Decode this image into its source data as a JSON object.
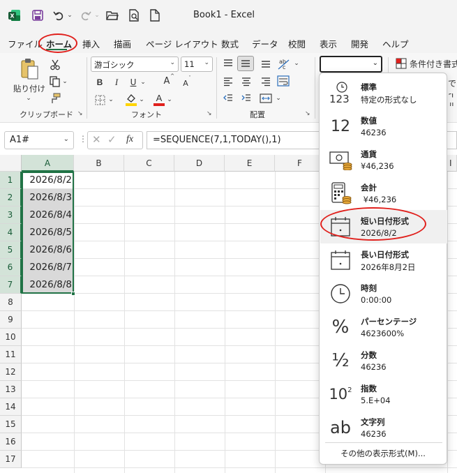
{
  "title_bar": {
    "app_title": "Book1  -  Excel",
    "icons": [
      "excel-logo-icon",
      "save-icon",
      "undo-icon",
      "redo-icon",
      "open-folder-icon",
      "print-preview-icon",
      "new-document-icon"
    ]
  },
  "menu": {
    "tabs": [
      "ファイル",
      "ホーム",
      "挿入",
      "描画",
      "ページ レイアウト",
      "数式",
      "データ",
      "校閲",
      "表示",
      "開発",
      "ヘルプ"
    ],
    "active_tab": "ホーム"
  },
  "ribbon": {
    "clipboard": {
      "paste_label": "貼り付け",
      "group_label": "クリップボード"
    },
    "font": {
      "font_name": "游ゴシック",
      "font_size": "11",
      "bold": "B",
      "italic": "I",
      "underline": "U",
      "grow_font": "A",
      "shrink_font": "A",
      "group_label": "フォント",
      "fill_color": "#ffd400",
      "font_color": "#e0201c"
    },
    "alignment": {
      "group_label": "配置"
    },
    "styles": {
      "conditional_formatting_label": "条件付き書式",
      "partial_1": "で",
      "partial_2": "イル"
    }
  },
  "formula_bar": {
    "name_box": "A1#",
    "fx_label": "fx",
    "formula": "=SEQUENCE(7,1,TODAY(),1)"
  },
  "grid": {
    "columns": [
      "A",
      "B",
      "C",
      "D",
      "E",
      "F",
      "I"
    ],
    "rows": [
      "1",
      "2",
      "3",
      "4",
      "5",
      "6",
      "7",
      "8",
      "9",
      "10",
      "11",
      "12",
      "13",
      "14",
      "15",
      "16",
      "17"
    ],
    "cells_A": [
      "2026/8/2",
      "2026/8/3",
      "2026/8/4",
      "2026/8/5",
      "2026/8/6",
      "2026/8/7",
      "2026/8/8"
    ],
    "accent_color": "#217346"
  },
  "number_format_menu": {
    "items": [
      {
        "name": "標準",
        "sample": "特定の形式なし",
        "icon": "general-123-icon"
      },
      {
        "name": "数値",
        "sample": "46236",
        "icon": "number-12-icon"
      },
      {
        "name": "通貨",
        "sample": "¥46,236",
        "icon": "currency-icon"
      },
      {
        "name": "会計",
        "sample": " ¥46,236",
        "icon": "accounting-icon"
      },
      {
        "name": "短い日付形式",
        "sample": "2026/8/2",
        "icon": "short-date-calendar-icon"
      },
      {
        "name": "長い日付形式",
        "sample": "2026年8月2日",
        "icon": "long-date-calendar-icon"
      },
      {
        "name": "時刻",
        "sample": "0:00:00",
        "icon": "clock-icon"
      },
      {
        "name": "パーセンテージ",
        "sample": "4623600%",
        "icon": "percent-icon"
      },
      {
        "name": "分数",
        "sample": "46236",
        "icon": "fraction-icon"
      },
      {
        "name": "指数",
        "sample": "5.E+04",
        "icon": "scientific-icon"
      },
      {
        "name": "文字列",
        "sample": "46236",
        "icon": "text-ab-icon"
      }
    ],
    "more_formats": "その他の表示形式(M)..."
  },
  "glyphs": {
    "general": "123",
    "number": "12",
    "percent": "%",
    "fraction": "½",
    "scientific_base": "10",
    "scientific_exp": "2",
    "text": "ab"
  },
  "annotation_color": "#e0201c"
}
